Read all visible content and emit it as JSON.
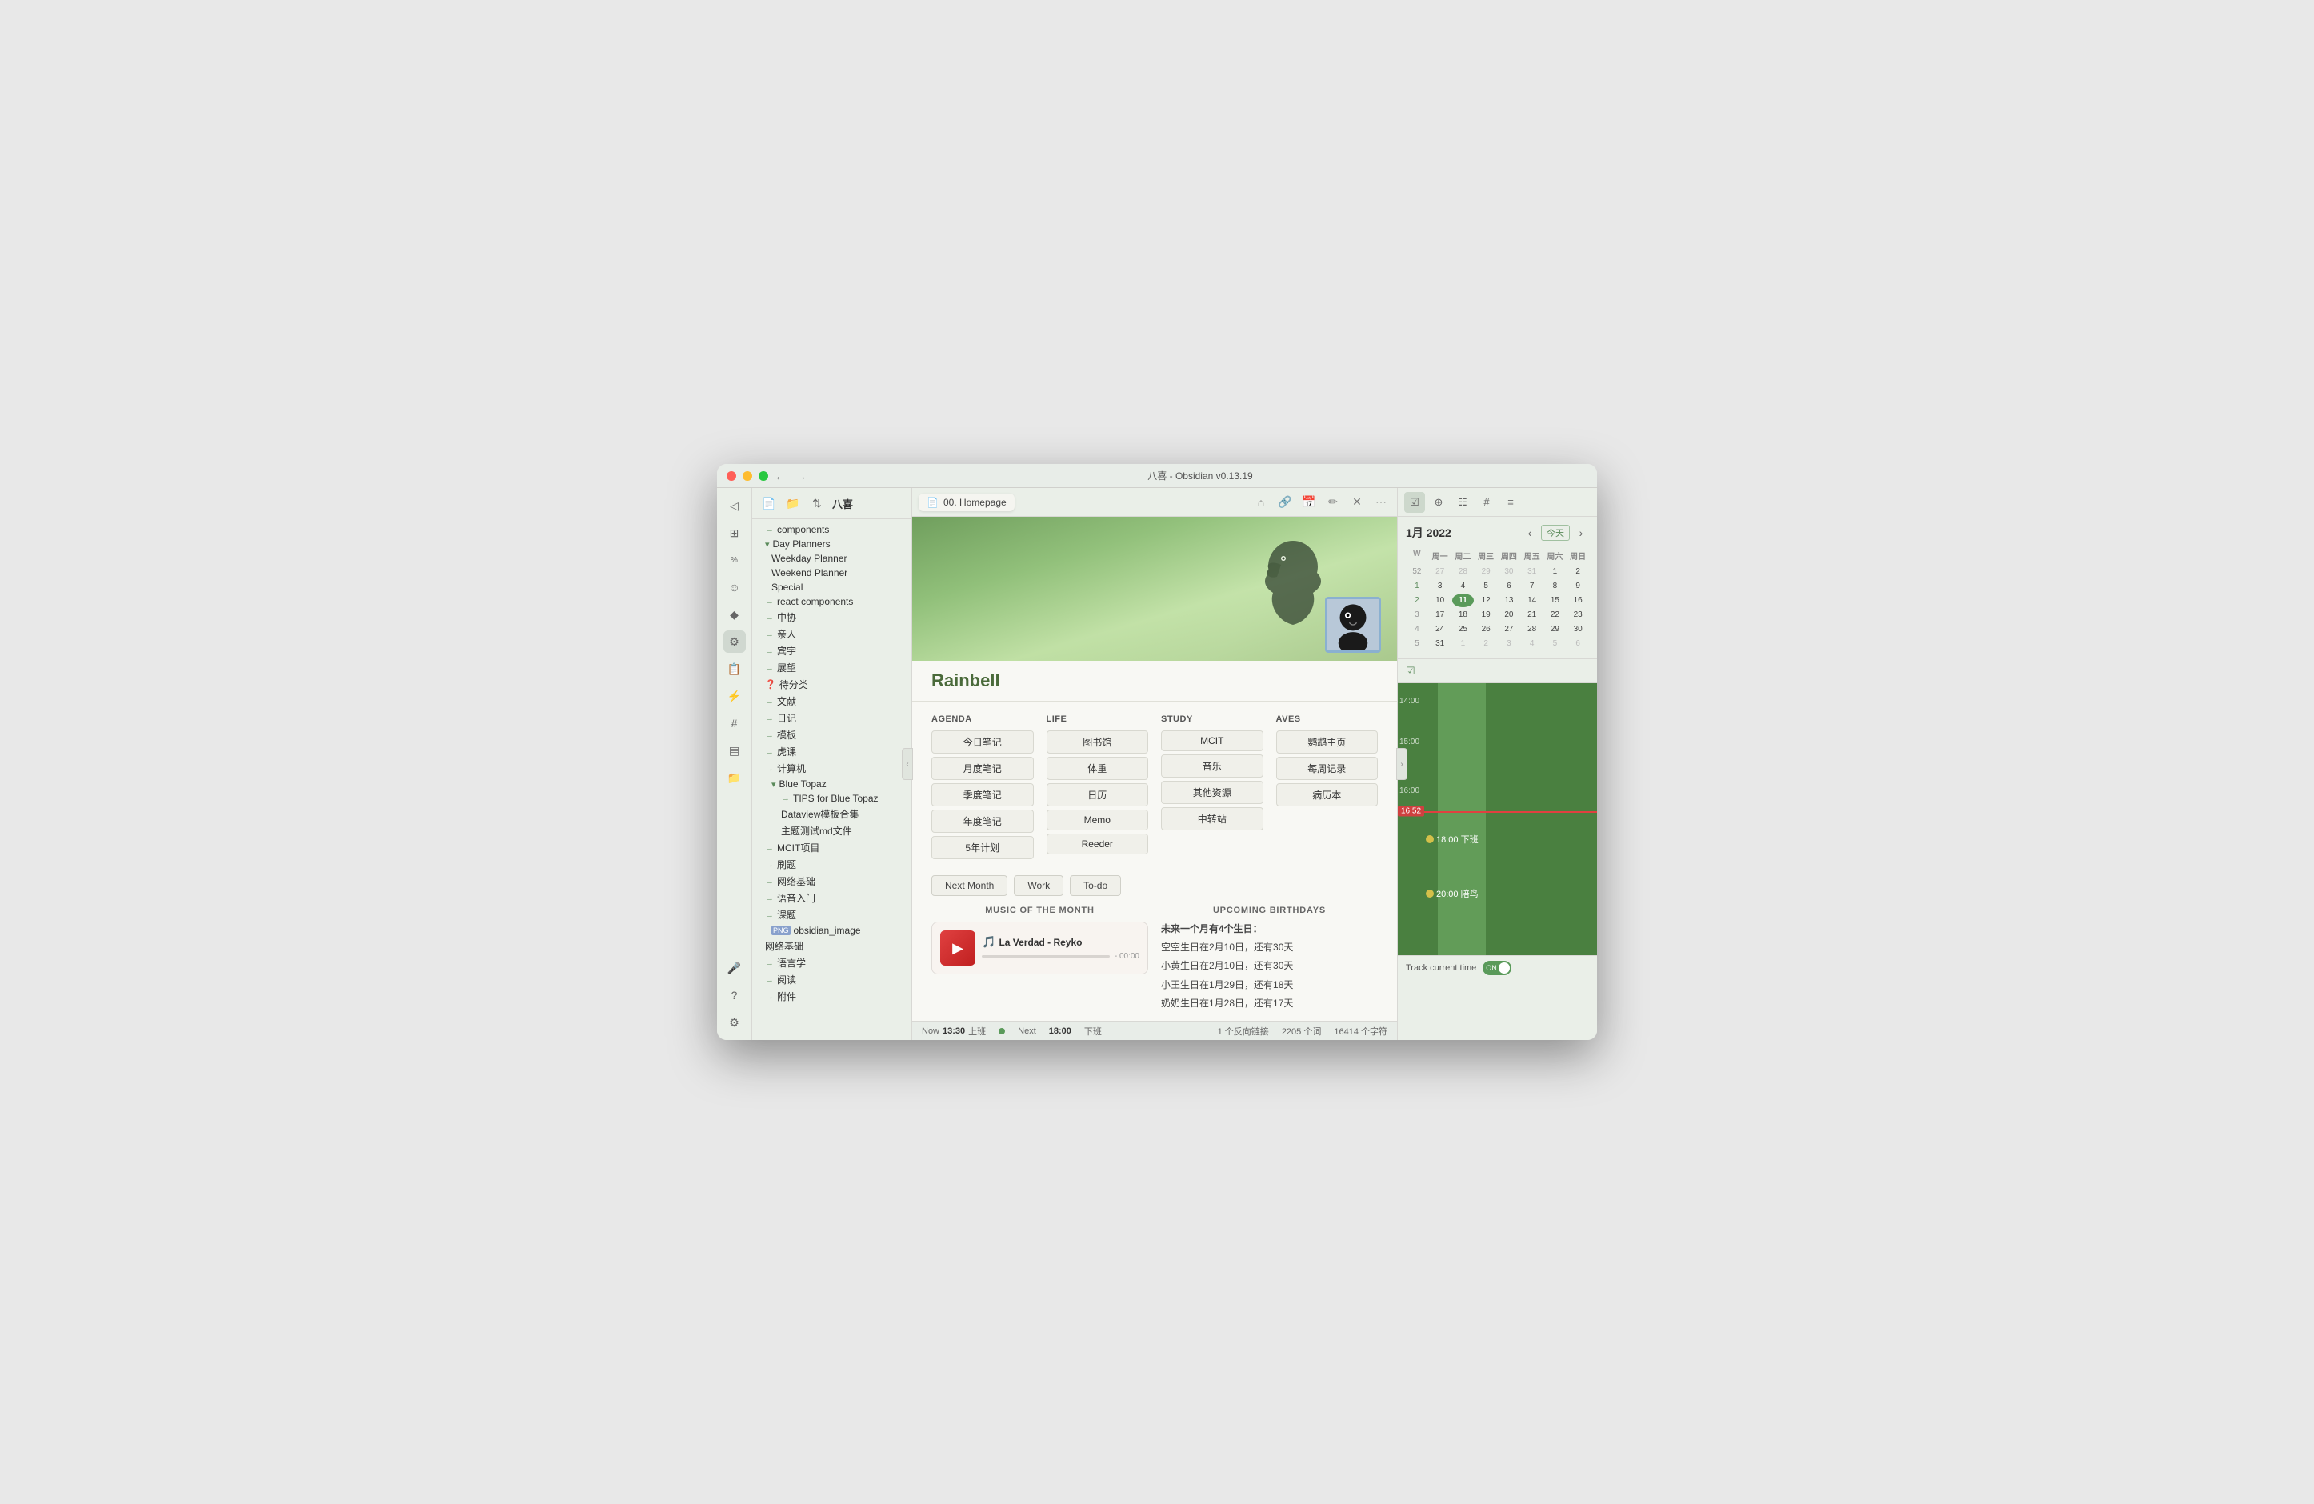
{
  "window": {
    "title": "八喜 - Obsidian v0.13.19",
    "back_btn": "←",
    "fwd_btn": "→"
  },
  "sidebar": {
    "vault_name": "八喜",
    "new_file": "📄",
    "new_folder": "📁",
    "sort": "⇅",
    "items": [
      {
        "id": "components",
        "label": "components",
        "indent": 0,
        "icon": "→",
        "type": "link"
      },
      {
        "id": "day-planners",
        "label": "Day Planners",
        "indent": 0,
        "icon": "▾",
        "type": "folder"
      },
      {
        "id": "weekday-planner",
        "label": "Weekday Planner",
        "indent": 1,
        "icon": "",
        "type": "file"
      },
      {
        "id": "weekend-planner",
        "label": "Weekend Planner",
        "indent": 1,
        "icon": "",
        "type": "file"
      },
      {
        "id": "special",
        "label": "Special",
        "indent": 1,
        "icon": "",
        "type": "file"
      },
      {
        "id": "react-components",
        "label": "react components",
        "indent": 0,
        "icon": "→",
        "type": "link"
      },
      {
        "id": "zhongxie",
        "label": "中协",
        "indent": 0,
        "icon": "→",
        "type": "link"
      },
      {
        "id": "qinren",
        "label": "亲人",
        "indent": 0,
        "icon": "→",
        "type": "link"
      },
      {
        "id": "binyu",
        "label": "宾宇",
        "indent": 0,
        "icon": "→",
        "type": "link"
      },
      {
        "id": "zhanlan",
        "label": "展望",
        "indent": 0,
        "icon": "→",
        "type": "link"
      },
      {
        "id": "daifenlei",
        "label": "待分类",
        "indent": 0,
        "icon": "→",
        "type": "link"
      },
      {
        "id": "wenxian",
        "label": "文献",
        "indent": 0,
        "icon": "→",
        "type": "link"
      },
      {
        "id": "riji",
        "label": "日记",
        "indent": 0,
        "icon": "→",
        "type": "link"
      },
      {
        "id": "muban",
        "label": "模板",
        "indent": 0,
        "icon": "→",
        "type": "link"
      },
      {
        "id": "huke",
        "label": "虎课",
        "indent": 0,
        "icon": "→",
        "type": "link"
      },
      {
        "id": "jisuanji",
        "label": "计算机",
        "indent": 0,
        "icon": "→",
        "type": "link"
      },
      {
        "id": "blue-topaz",
        "label": "Blue Topaz",
        "indent": 1,
        "icon": "▾",
        "type": "folder"
      },
      {
        "id": "tips-blue-topaz",
        "label": "TIPS for Blue Topaz",
        "indent": 2,
        "icon": "→",
        "type": "link"
      },
      {
        "id": "dataview",
        "label": "Dataview模板合集",
        "indent": 2,
        "icon": "",
        "type": "file"
      },
      {
        "id": "zhuti",
        "label": "主题测试md文件",
        "indent": 2,
        "icon": "",
        "type": "file"
      },
      {
        "id": "mcit",
        "label": "MCIT项目",
        "indent": 0,
        "icon": "→",
        "type": "link"
      },
      {
        "id": "shuti",
        "label": "刷题",
        "indent": 0,
        "icon": "→",
        "type": "link"
      },
      {
        "id": "wangluo-jc",
        "label": "网络基础",
        "indent": 0,
        "icon": "→",
        "type": "link"
      },
      {
        "id": "yuyan-rumen",
        "label": "语音入门",
        "indent": 0,
        "icon": "→",
        "type": "link"
      },
      {
        "id": "kecheng",
        "label": "课题",
        "indent": 0,
        "icon": "→",
        "type": "link"
      },
      {
        "id": "obsidian-image",
        "label": "obsidian_image",
        "indent": 1,
        "icon": "PNG",
        "type": "png"
      },
      {
        "id": "wangluo",
        "label": "网络基础",
        "indent": 0,
        "icon": "",
        "type": "file"
      },
      {
        "id": "yuyanxue",
        "label": "语言学",
        "indent": 0,
        "icon": "→",
        "type": "link"
      },
      {
        "id": "yuedu",
        "label": "阅读",
        "indent": 0,
        "icon": "→",
        "type": "link"
      },
      {
        "id": "fuji",
        "label": "附件",
        "indent": 0,
        "icon": "→",
        "type": "link"
      }
    ]
  },
  "tab": {
    "title": "00. Homepage",
    "icon": "📄"
  },
  "toolbar": {
    "home": "⌂",
    "link": "🔗",
    "calendar": "📅",
    "edit": "✏",
    "close": "✕",
    "more": "⋯"
  },
  "hero": {
    "name": "Rainbell",
    "avatar_alt": "bird avatar"
  },
  "agenda_section": {
    "title": "AGENDA",
    "buttons": [
      "今日笔记",
      "月度笔记",
      "季度笔记",
      "年度笔记",
      "5年计划"
    ]
  },
  "life_section": {
    "title": "LIFE",
    "buttons": [
      "图书馆",
      "体重",
      "日历",
      "Memo",
      "Reeder"
    ]
  },
  "study_section": {
    "title": "STUDY",
    "buttons": [
      "MCIT",
      "音乐",
      "其他资源",
      "中转站"
    ]
  },
  "aves_section": {
    "title": "AVES",
    "buttons": [
      "鹦鹉主页",
      "每周记录",
      "病历本"
    ]
  },
  "actions": {
    "buttons": [
      "Next Month",
      "Work",
      "To-do"
    ]
  },
  "music": {
    "section_title": "MUSIC OF THE MONTH",
    "title": "La Verdad",
    "artist": "Reyko",
    "time": "- 00:00"
  },
  "birthdays": {
    "section_title": "UPCOMING BIRTHDAYS",
    "lead": "未来一个月有4个生日：",
    "items": [
      "空空生日在2月10日，还有30天",
      "小黄生日在2月10日，还有30天",
      "小王生日在1月29日，还有18天",
      "奶奶生日在1月28日，还有17天"
    ]
  },
  "status_bar": {
    "now_label": "Now",
    "now_time": "13:30",
    "now_event": "上班",
    "next_label": "Next",
    "next_time": "18:00",
    "next_event": "下班",
    "backlinks": "1 个反向链接",
    "words": "2205 个词",
    "chars": "16414 个字符"
  },
  "calendar": {
    "month": "1月",
    "year": "2022",
    "today_btn": "今天",
    "nav_prev": "‹",
    "nav_next": "›",
    "headers": [
      "W",
      "周一",
      "周二",
      "周三",
      "周四",
      "周五",
      "周六",
      "周日"
    ],
    "weeks": [
      {
        "week": "52",
        "days": [
          "27",
          "28",
          "29",
          "30",
          "31",
          "1",
          "2"
        ],
        "other": [
          true,
          true,
          true,
          true,
          true,
          false,
          false
        ]
      },
      {
        "week": "1",
        "days": [
          "3",
          "4",
          "5",
          "6",
          "7",
          "8",
          "9"
        ],
        "other": [
          false,
          false,
          false,
          false,
          false,
          false,
          false
        ]
      },
      {
        "week": "2",
        "days": [
          "10",
          "11",
          "12",
          "13",
          "14",
          "15",
          "16"
        ],
        "other": [
          false,
          false,
          false,
          false,
          false,
          false,
          false
        ],
        "today": 1,
        "has_dot": true
      },
      {
        "week": "3",
        "days": [
          "17",
          "18",
          "19",
          "20",
          "21",
          "22",
          "23"
        ],
        "other": [
          false,
          false,
          false,
          false,
          false,
          false,
          false
        ]
      },
      {
        "week": "4",
        "days": [
          "24",
          "25",
          "26",
          "27",
          "28",
          "29",
          "30"
        ],
        "other": [
          false,
          false,
          false,
          false,
          false,
          false,
          false
        ]
      },
      {
        "week": "5",
        "days": [
          "31",
          "1",
          "2",
          "3",
          "4",
          "5",
          "6"
        ],
        "other": [
          false,
          true,
          true,
          true,
          true,
          true,
          true
        ]
      }
    ]
  },
  "timeline": {
    "current_time": "16:52",
    "events": [
      {
        "time": "18:00",
        "label": "下班"
      },
      {
        "time": "20:00",
        "label": "陪鸟"
      }
    ],
    "track_label": "Track current time",
    "toggle_on": "ON"
  },
  "icon_rail": {
    "icons": [
      "⊞",
      "<%",
      "☰",
      "♦",
      "🕸",
      "⚙",
      "📋",
      "⚡",
      "☁",
      "📸",
      "?",
      "⚙"
    ]
  },
  "right_panel_tabs": {
    "tabs": [
      "☑",
      "⊕",
      "☷",
      "#",
      "≡"
    ]
  }
}
